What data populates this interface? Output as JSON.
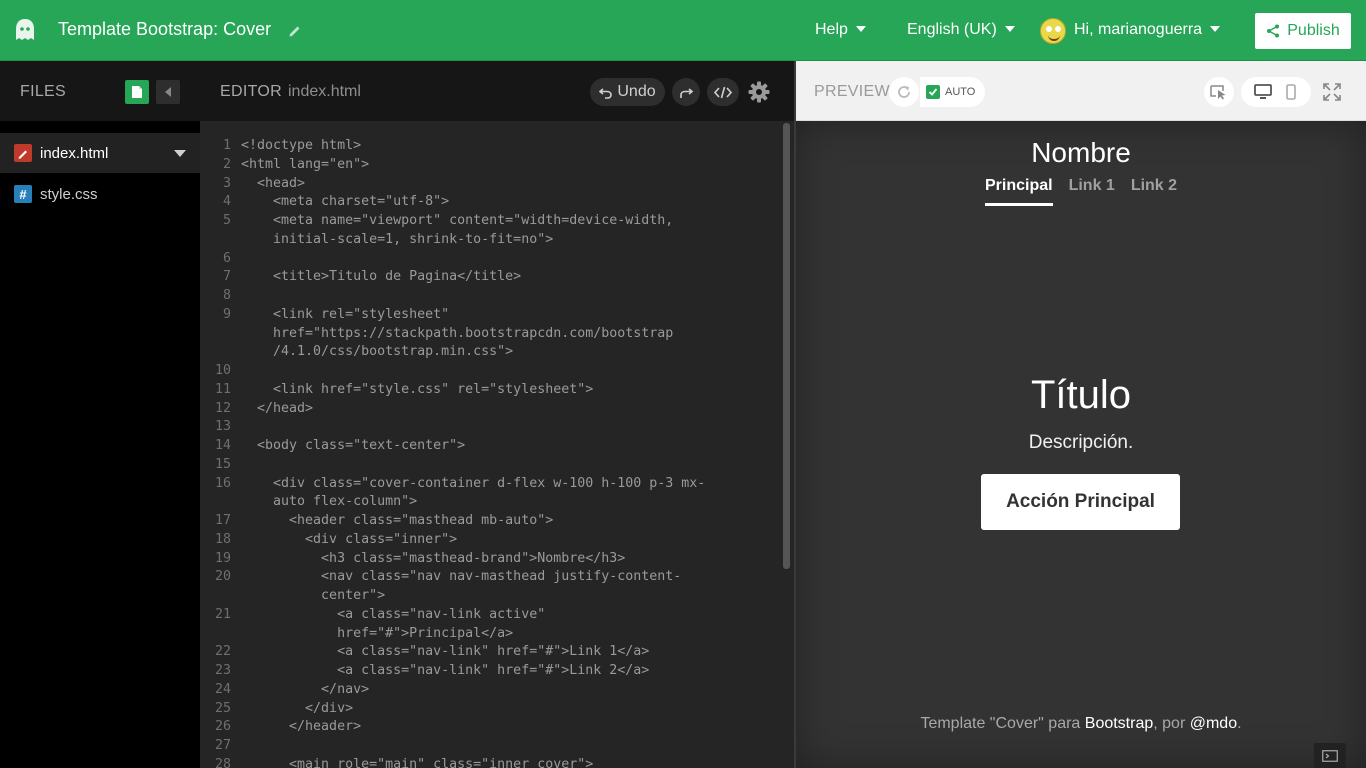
{
  "topbar": {
    "title": "Template Bootstrap: Cover",
    "help": "Help",
    "language": "English (UK)",
    "user": "Hi, marianoguerra",
    "publish": "Publish",
    "accent": "#26a656"
  },
  "sidebar": {
    "label": "FILES",
    "files": [
      {
        "name": "index.html",
        "icon": "html-file-icon",
        "color": "#c0392b"
      },
      {
        "name": "style.css",
        "icon": "css-file-icon",
        "color": "#2980b9",
        "glyph": "#"
      }
    ]
  },
  "editor": {
    "label": "EDITOR",
    "filename": "index.html",
    "undo": "Undo"
  },
  "preview": {
    "label": "PREVIEW",
    "auto": "AUTO",
    "brand": "Nombre",
    "nav": [
      "Principal",
      "Link 1",
      "Link 2"
    ],
    "title": "Título",
    "description": "Descripción.",
    "button": "Acción Principal",
    "footer": {
      "pre": "Template \"Cover\" para ",
      "link1": "Bootstrap",
      "mid": ", por ",
      "link2": "@mdo",
      "post": "."
    }
  },
  "code": [
    {
      "n": "1",
      "t": "<!doctype html>"
    },
    {
      "n": "2",
      "t": "<html lang=\"en\">"
    },
    {
      "n": "3",
      "t": "  <head>"
    },
    {
      "n": "4",
      "t": "    <meta charset=\"utf-8\">"
    },
    {
      "n": "5",
      "t": "    <meta name=\"viewport\" content=\"width=device-width,"
    },
    {
      "n": "",
      "t": "    initial-scale=1, shrink-to-fit=no\">"
    },
    {
      "n": "6",
      "t": ""
    },
    {
      "n": "7",
      "t": "    <title>Titulo de Pagina</title>"
    },
    {
      "n": "8",
      "t": ""
    },
    {
      "n": "9",
      "t": "    <link rel=\"stylesheet\""
    },
    {
      "n": "",
      "t": "    href=\"https://stackpath.bootstrapcdn.com/bootstrap"
    },
    {
      "n": "",
      "t": "    /4.1.0/css/bootstrap.min.css\">"
    },
    {
      "n": "10",
      "t": ""
    },
    {
      "n": "11",
      "t": "    <link href=\"style.css\" rel=\"stylesheet\">"
    },
    {
      "n": "12",
      "t": "  </head>"
    },
    {
      "n": "13",
      "t": ""
    },
    {
      "n": "14",
      "t": "  <body class=\"text-center\">"
    },
    {
      "n": "15",
      "t": ""
    },
    {
      "n": "16",
      "t": "    <div class=\"cover-container d-flex w-100 h-100 p-3 mx-"
    },
    {
      "n": "",
      "t": "    auto flex-column\">"
    },
    {
      "n": "17",
      "t": "      <header class=\"masthead mb-auto\">"
    },
    {
      "n": "18",
      "t": "        <div class=\"inner\">"
    },
    {
      "n": "19",
      "t": "          <h3 class=\"masthead-brand\">Nombre</h3>"
    },
    {
      "n": "20",
      "t": "          <nav class=\"nav nav-masthead justify-content-"
    },
    {
      "n": "",
      "t": "          center\">"
    },
    {
      "n": "21",
      "t": "            <a class=\"nav-link active\""
    },
    {
      "n": "",
      "t": "            href=\"#\">Principal</a>"
    },
    {
      "n": "22",
      "t": "            <a class=\"nav-link\" href=\"#\">Link 1</a>"
    },
    {
      "n": "23",
      "t": "            <a class=\"nav-link\" href=\"#\">Link 2</a>"
    },
    {
      "n": "24",
      "t": "          </nav>"
    },
    {
      "n": "25",
      "t": "        </div>"
    },
    {
      "n": "26",
      "t": "      </header>"
    },
    {
      "n": "27",
      "t": ""
    },
    {
      "n": "28",
      "t": "      <main role=\"main\" class=\"inner cover\">"
    }
  ]
}
